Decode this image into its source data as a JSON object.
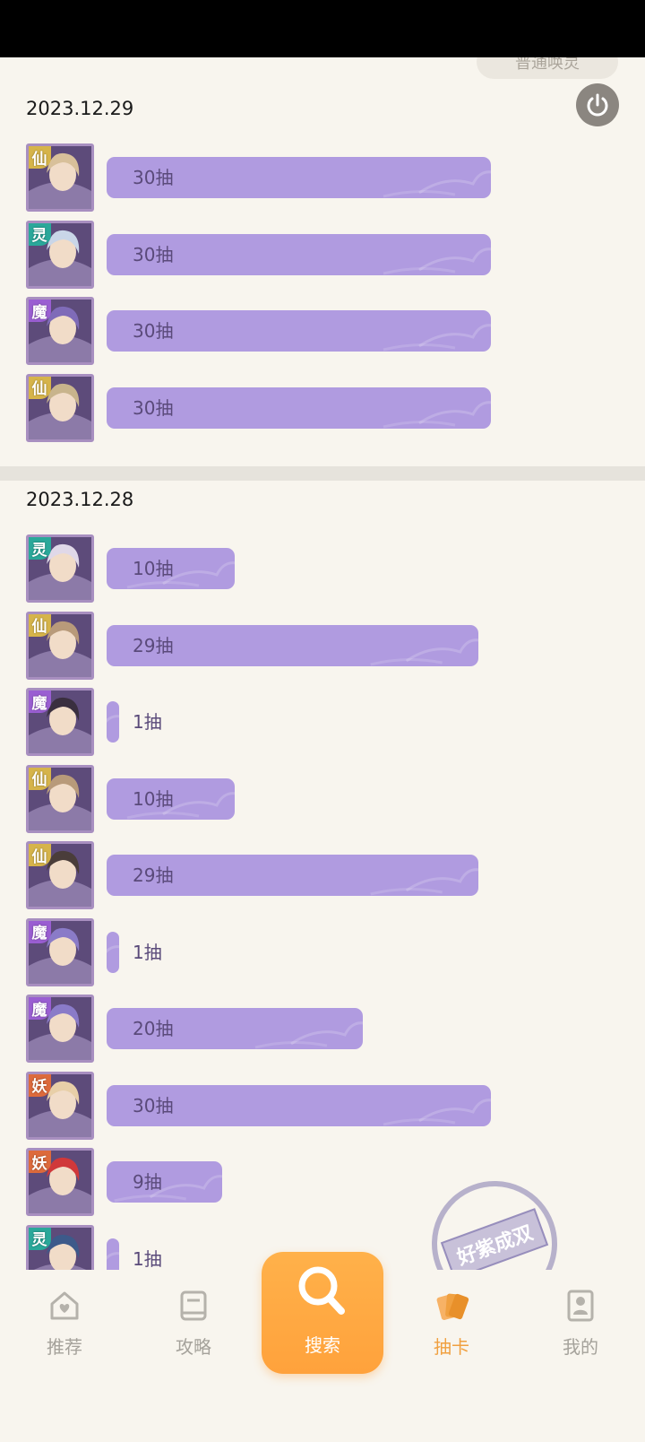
{
  "top_pill": "普通唤灵",
  "sections": [
    {
      "date": "2023.12.29",
      "rows": [
        {
          "faction": "仙",
          "draws": "30抽",
          "fill": 30
        },
        {
          "faction": "灵",
          "draws": "30抽",
          "fill": 30
        },
        {
          "faction": "魔",
          "draws": "30抽",
          "fill": 30
        },
        {
          "faction": "仙",
          "draws": "30抽",
          "fill": 30
        }
      ]
    },
    {
      "date": "2023.12.28",
      "rows": [
        {
          "faction": "灵",
          "draws": "10抽",
          "fill": 10
        },
        {
          "faction": "仙",
          "draws": "29抽",
          "fill": 29
        },
        {
          "faction": "魔",
          "draws": "1抽",
          "fill": 1
        },
        {
          "faction": "仙",
          "draws": "10抽",
          "fill": 10
        },
        {
          "faction": "仙",
          "draws": "29抽",
          "fill": 29
        },
        {
          "faction": "魔",
          "draws": "1抽",
          "fill": 1
        },
        {
          "faction": "魔",
          "draws": "20抽",
          "fill": 20
        },
        {
          "faction": "妖",
          "draws": "30抽",
          "fill": 30
        },
        {
          "faction": "妖",
          "draws": "9抽",
          "fill": 9
        },
        {
          "faction": "灵",
          "draws": "1抽",
          "fill": 1
        }
      ]
    }
  ],
  "stamp": "好紫成双",
  "nav": {
    "home": "推荐",
    "guide": "攻略",
    "search": "搜索",
    "gacha": "抽卡",
    "mine": "我的"
  },
  "colors": {
    "bar": "#b09be0",
    "accent": "#f0a040",
    "xian": "#d6b44a",
    "ling": "#2aa89a",
    "mo": "#9a5ed2",
    "yao": "#dd6a3c"
  }
}
